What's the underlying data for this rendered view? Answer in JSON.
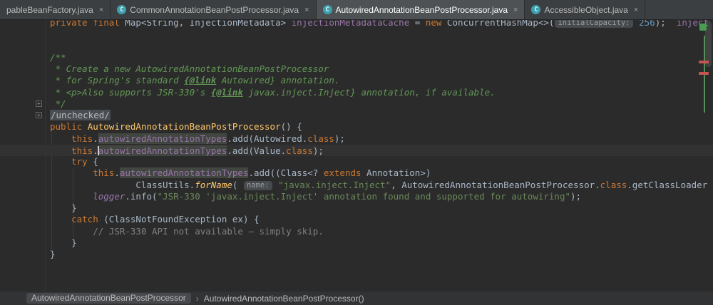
{
  "icons": {
    "close": "×",
    "java_class_letter": "C",
    "breadcrumb_separator": "›",
    "fold_plus": "+"
  },
  "theme": {
    "editor_bg": "#2b2b2b",
    "tab_bar_bg": "#3c3f41",
    "active_tab_bg": "#4e5254",
    "current_line_bg": "#323232",
    "keyword": "#cc7832",
    "string": "#6a8759",
    "number": "#6897bb",
    "doc_comment": "#629755",
    "line_comment": "#808080",
    "field": "#9876aa",
    "method_declaration": "#ffc66b",
    "default_text": "#a9b7c6",
    "identifier_highlight_bg": "#424640"
  },
  "tab_bar": {
    "tabs": [
      {
        "label": "pableBeanFactory.java",
        "active": false,
        "icon": false
      },
      {
        "label": "CommonAnnotationBeanPostProcessor.java",
        "active": false,
        "icon": true
      },
      {
        "label": "AutowiredAnnotationBeanPostProcessor.java",
        "active": true,
        "icon": true
      },
      {
        "label": "AccessibleObject.java",
        "active": false,
        "icon": true
      }
    ]
  },
  "editor": {
    "lines": [
      {
        "seg": [
          [
            "kw",
            "private final "
          ],
          [
            "d",
            "Map<String, InjectionMetadata> "
          ],
          [
            "field",
            "injectionMetadataCache "
          ],
          [
            "d",
            "= "
          ],
          [
            "kw",
            "new "
          ],
          [
            "d",
            "ConcurrentHashMap<>("
          ],
          [
            "hint",
            "initialCapacity:"
          ],
          [
            "num",
            " 256"
          ],
          [
            "d",
            ");  "
          ],
          [
            "field",
            "inject"
          ]
        ]
      },
      {
        "seg": []
      },
      {
        "seg": []
      },
      {
        "seg": [
          [
            "doc",
            "/**"
          ]
        ]
      },
      {
        "seg": [
          [
            "doc",
            " * Create a new AutowiredAnnotationBeanPostProcessor"
          ]
        ]
      },
      {
        "seg": [
          [
            "doc",
            " * for Spring's standard "
          ],
          [
            "doctag",
            "{@link"
          ],
          [
            "doc",
            " Autowired} annotation."
          ]
        ]
      },
      {
        "seg": [
          [
            "doc",
            " * <p>Also supports JSR-330's "
          ],
          [
            "doctag",
            "{@link"
          ],
          [
            "doc",
            " javax.inject.Inject} annotation, if available."
          ]
        ]
      },
      {
        "seg": [
          [
            "doc",
            " */"
          ]
        ]
      },
      {
        "seg": [
          [
            "fold",
            "/unchecked/"
          ]
        ]
      },
      {
        "seg": [
          [
            "kw",
            "public "
          ],
          [
            "decl",
            "AutowiredAnnotationBeanPostProcessor"
          ],
          [
            "d",
            "() {"
          ]
        ]
      },
      {
        "seg": [
          [
            "d",
            "    "
          ],
          [
            "kw",
            "this"
          ],
          [
            "d",
            "."
          ],
          [
            "field hl",
            "autowiredAnnotationTypes"
          ],
          [
            "d",
            ".add(Autowired."
          ],
          [
            "kw",
            "class"
          ],
          [
            "d",
            ");"
          ]
        ]
      },
      {
        "cur": true,
        "seg": [
          [
            "d",
            "    "
          ],
          [
            "kw",
            "this"
          ],
          [
            "d",
            "."
          ],
          [
            "caret",
            ""
          ],
          [
            "field hl",
            "autowiredAnnotationTypes"
          ],
          [
            "d",
            ".add(Value."
          ],
          [
            "kw",
            "class"
          ],
          [
            "d",
            ");"
          ]
        ]
      },
      {
        "seg": [
          [
            "d",
            "    "
          ],
          [
            "kw",
            "try"
          ],
          [
            "d",
            " {"
          ]
        ]
      },
      {
        "seg": [
          [
            "d",
            "        "
          ],
          [
            "kw",
            "this"
          ],
          [
            "d",
            "."
          ],
          [
            "field hl",
            "autowiredAnnotationTypes"
          ],
          [
            "d",
            ".add((Class<? "
          ],
          [
            "kw",
            "extends"
          ],
          [
            "d",
            " Annotation>)"
          ]
        ]
      },
      {
        "seg": [
          [
            "d",
            "                ClassUtils."
          ],
          [
            "sm",
            "forName"
          ],
          [
            "d",
            "( "
          ],
          [
            "hint",
            "name:"
          ],
          [
            "d",
            " "
          ],
          [
            "str",
            "\"javax.inject.Inject\""
          ],
          [
            "d",
            ", AutowiredAnnotationBeanPostProcessor."
          ],
          [
            "kw",
            "class"
          ],
          [
            "d",
            ".getClassLoader"
          ]
        ]
      },
      {
        "seg": [
          [
            "d",
            "        "
          ],
          [
            "field it",
            "logger"
          ],
          [
            "d",
            ".info("
          ],
          [
            "str",
            "\"JSR-330 'javax.inject.Inject' annotation found and supported for autowiring\""
          ],
          [
            "d",
            ");"
          ]
        ]
      },
      {
        "seg": [
          [
            "d",
            "    }"
          ]
        ]
      },
      {
        "seg": [
          [
            "d",
            "    "
          ],
          [
            "kw",
            "catch"
          ],
          [
            "d",
            " (ClassNotFoundException ex) {"
          ]
        ]
      },
      {
        "seg": [
          [
            "d",
            "        "
          ],
          [
            "cmt",
            "// JSR-330 API not available — simply skip."
          ]
        ]
      },
      {
        "seg": [
          [
            "d",
            "    }"
          ]
        ]
      },
      {
        "seg": [
          [
            "d",
            "}"
          ]
        ]
      }
    ]
  },
  "scrollbar": {
    "inspection_indicator_color": "#499c54",
    "error_mark_color": "#c75450",
    "change_bar_color": "#549159"
  },
  "breadcrumbs": {
    "separator": "›",
    "items": [
      "AutowiredAnnotationBeanPostProcessor",
      "AutowiredAnnotationBeanPostProcessor()"
    ]
  }
}
